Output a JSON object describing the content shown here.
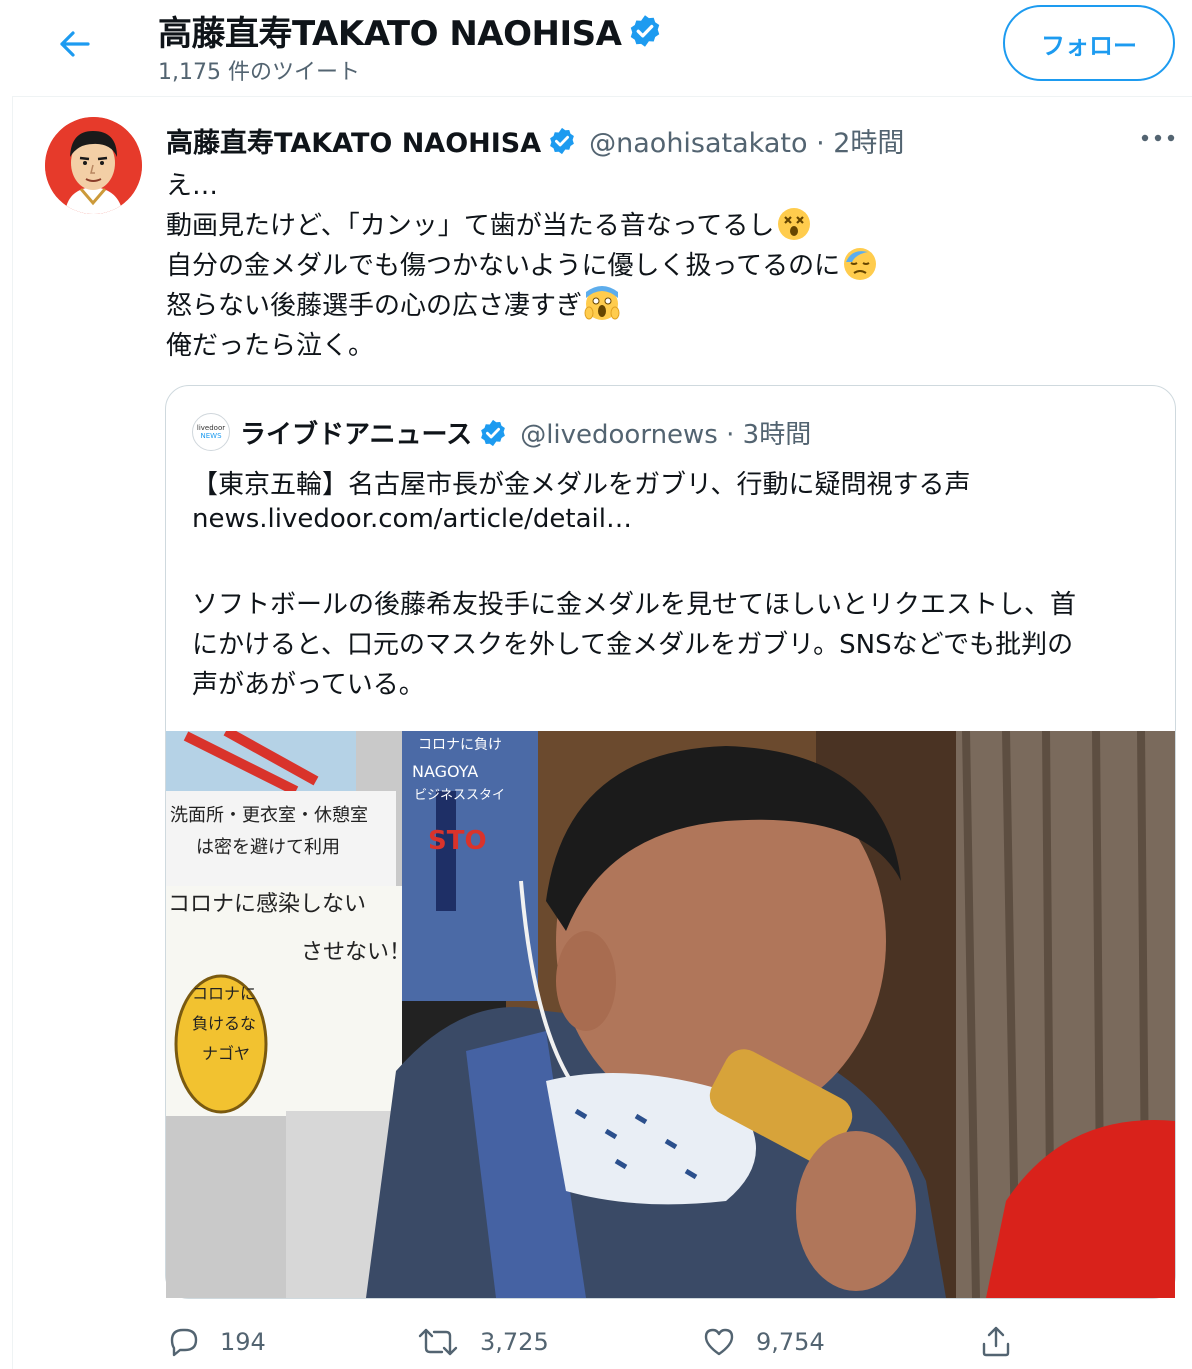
{
  "header": {
    "title": "高藤直寿TAKATO NAOHISA",
    "tweet_count": "1,175 件のツイート",
    "follow_label": "フォロー"
  },
  "tweet": {
    "display_name": "高藤直寿TAKATO NAOHISA",
    "handle_time": "@naohisatakato · 2時間",
    "lines": [
      "え…",
      "動画見たけど、「カンッ」て歯が当たる音なってるし",
      "自分の金メダルでも傷つかないように優しく扱ってるのに",
      "怒らない後藤選手の心の広さ凄すぎ",
      "俺だったら泣く。"
    ],
    "emoji_names": [
      "dizzy-face-emoji",
      "downcast-sweat-emoji",
      "scream-emoji"
    ]
  },
  "quoted": {
    "avatar_text_1": "livedoor",
    "avatar_text_2": "NEWS",
    "display_name": "ライブドアニュース",
    "handle_time": "@livedoornews · 3時間",
    "headline": "【東京五輪】名古屋市長が金メダルをガブリ、行動に疑問視する声",
    "link": "news.livedoor.com/article/detail…",
    "summary": [
      "ソフトボールの後藤希友投手に金メダルを見せてほしいとリクエストし、首",
      "にかけると、口元のマスクを外して金メダルをガブリ。SNSなどでも批判の",
      "声があがっている。"
    ],
    "photo_texts": {
      "poster_left_1": "洗面所・更衣室・休憩室",
      "poster_left_2": "は密を避けて利用",
      "poster_left_3": "コロナに感染しない",
      "poster_left_4": "させない！",
      "mascot_1": "コロナに",
      "mascot_2": "負けるな",
      "mascot_3": "ナゴヤ",
      "poster_right_1": "コロナに負け",
      "poster_right_2": "NAGOYA",
      "poster_right_3": "ビジネススタイ",
      "poster_right_4": "STO"
    }
  },
  "actions": {
    "reply_count": "194",
    "retweet_count": "3,725",
    "like_count": "9,754"
  },
  "colors": {
    "accent": "#1d9bf0",
    "secondary_text": "#536471",
    "border": "#cfd9de"
  }
}
